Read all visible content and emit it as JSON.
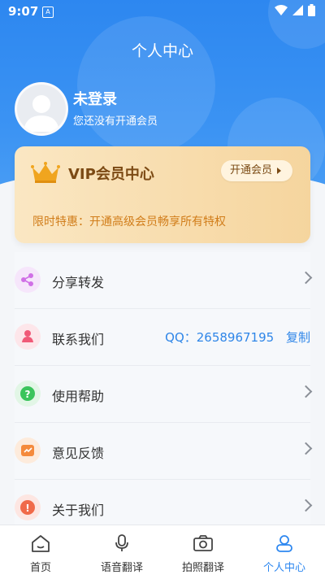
{
  "status_bar": {
    "time": "9:07",
    "notification_glyph": "A"
  },
  "header": {
    "title": "个人中心"
  },
  "user": {
    "name": "未登录",
    "subtitle": "您还没有开通会员"
  },
  "vip": {
    "title": "VIP会员中心",
    "button_label": "开通会员",
    "promo": "限时特惠：开通高级会员畅享所有特权"
  },
  "menu": [
    {
      "label": "分享转发",
      "icon": "share-icon",
      "icon_bg": "#f6e6fb",
      "icon_color": "#d070e6"
    },
    {
      "label": "联系我们",
      "icon": "contact-icon",
      "icon_bg": "#fde6ea",
      "icon_color": "#f05a78",
      "qq_text": "QQ：2658967195",
      "copy_label": "复制"
    },
    {
      "label": "使用帮助",
      "icon": "help-icon",
      "icon_bg": "#e2f6e6",
      "icon_color": "#3bc45c"
    },
    {
      "label": "意见反馈",
      "icon": "feedback-icon",
      "icon_bg": "#fdebdc",
      "icon_color": "#f48a3c"
    },
    {
      "label": "关于我们",
      "icon": "about-icon",
      "icon_bg": "#fde6e2",
      "icon_color": "#f06a4a"
    }
  ],
  "tabs": [
    {
      "label": "首页",
      "icon": "home-icon"
    },
    {
      "label": "语音翻译",
      "icon": "microphone-icon"
    },
    {
      "label": "拍照翻译",
      "icon": "camera-icon"
    },
    {
      "label": "个人中心",
      "icon": "person-icon",
      "active": true
    }
  ],
  "colors": {
    "primary": "#2d87f0",
    "vip_text": "#7c4a14",
    "promo": "#d17d1a",
    "link": "#2f86e8"
  }
}
